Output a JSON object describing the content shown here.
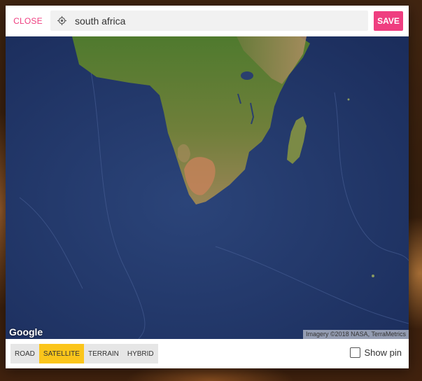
{
  "header": {
    "close_label": "CLOSE",
    "save_label": "SAVE",
    "search_value": "south africa",
    "search_icon": "location-crosshair-icon"
  },
  "map": {
    "logo_text": "Google",
    "attribution": "Imagery ©2018 NASA, TerraMetrics"
  },
  "footer": {
    "map_types": [
      "ROAD",
      "SATELLITE",
      "TERRAIN",
      "HYBRID"
    ],
    "active_map_type": "SATELLITE",
    "show_pin_label": "Show pin",
    "show_pin_checked": false
  },
  "colors": {
    "accent": "#ef3e80",
    "active_tab": "#fbc51b",
    "ocean": "#1f3467"
  }
}
